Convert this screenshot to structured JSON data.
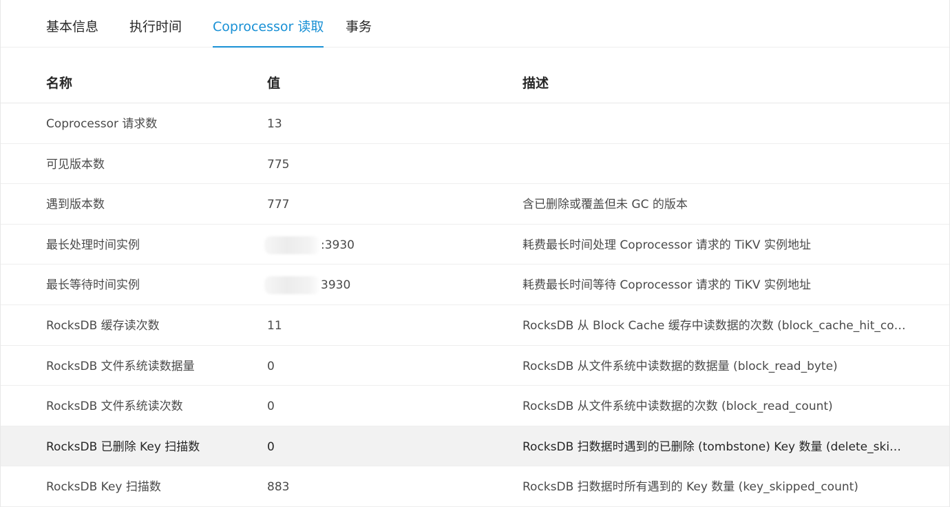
{
  "tabs": [
    {
      "label": "基本信息",
      "active": false
    },
    {
      "label": "执行时间",
      "active": false
    },
    {
      "label": "Coprocessor 读取",
      "active": true
    },
    {
      "label": "事务",
      "active": false
    }
  ],
  "table": {
    "headers": {
      "name": "名称",
      "value": "值",
      "description": "描述"
    },
    "rows": [
      {
        "name": "Coprocessor 请求数",
        "value": "13",
        "description": ""
      },
      {
        "name": "可见版本数",
        "value": "775",
        "description": ""
      },
      {
        "name": "遇到版本数",
        "value": "777",
        "description": "含已删除或覆盖但未 GC 的版本"
      },
      {
        "name": "最长处理时间实例",
        "value": ":3930",
        "description": "耗费最长时间处理 Coprocessor 请求的 TiKV 实例地址"
      },
      {
        "name": "最长等待时间实例",
        "value": "3930",
        "description": "耗费最长时间等待 Coprocessor 请求的 TiKV 实例地址"
      },
      {
        "name": "RocksDB 缓存读次数",
        "value": "11",
        "description": "RocksDB 从 Block Cache 缓存中读数据的次数 (block_cache_hit_count)"
      },
      {
        "name": "RocksDB 文件系统读数据量",
        "value": "0",
        "description": "RocksDB 从文件系统中读数据的数据量 (block_read_byte)"
      },
      {
        "name": "RocksDB 文件系统读次数",
        "value": "0",
        "description": "RocksDB 从文件系统中读数据的次数 (block_read_count)"
      },
      {
        "name": "RocksDB 已删除 Key 扫描数",
        "value": "0",
        "description": "RocksDB 扫数据时遇到的已删除 (tombstone) Key 数量 (delete_skipped…"
      },
      {
        "name": "RocksDB Key 扫描数",
        "value": "883",
        "description": "RocksDB 扫数据时所有遇到的 Key 数量 (key_skipped_count)"
      }
    ]
  },
  "colors": {
    "accent": "#1890d5",
    "highlight_row": "#f2f2f2"
  }
}
